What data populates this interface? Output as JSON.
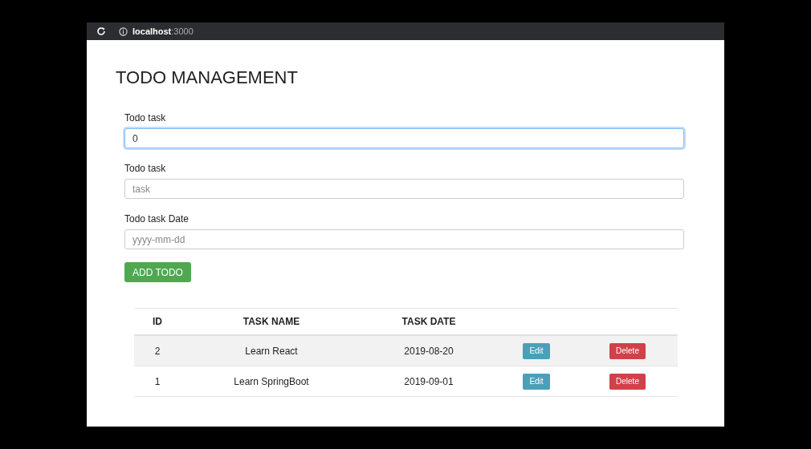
{
  "browser": {
    "host": "localhost",
    "port": ":3000"
  },
  "title": "TODO MANAGEMENT",
  "fields": [
    {
      "label": "Todo task",
      "value": "0",
      "focused": true
    },
    {
      "label": "Todo task",
      "placeholder": "task",
      "focused": false
    },
    {
      "label": "Todo task Date",
      "placeholder": "yyyy-mm-dd",
      "focused": false
    }
  ],
  "add_button": "ADD TODO",
  "table": {
    "columns": [
      "ID",
      "TASK NAME",
      "TASK DATE"
    ],
    "rows": [
      {
        "id": "2",
        "name": "Learn React",
        "date": "2019-08-20",
        "edit": "Edit",
        "delete": "Delete"
      },
      {
        "id": "1",
        "name": "Learn SpringBoot",
        "date": "2019-09-01",
        "edit": "Edit",
        "delete": "Delete"
      }
    ]
  }
}
